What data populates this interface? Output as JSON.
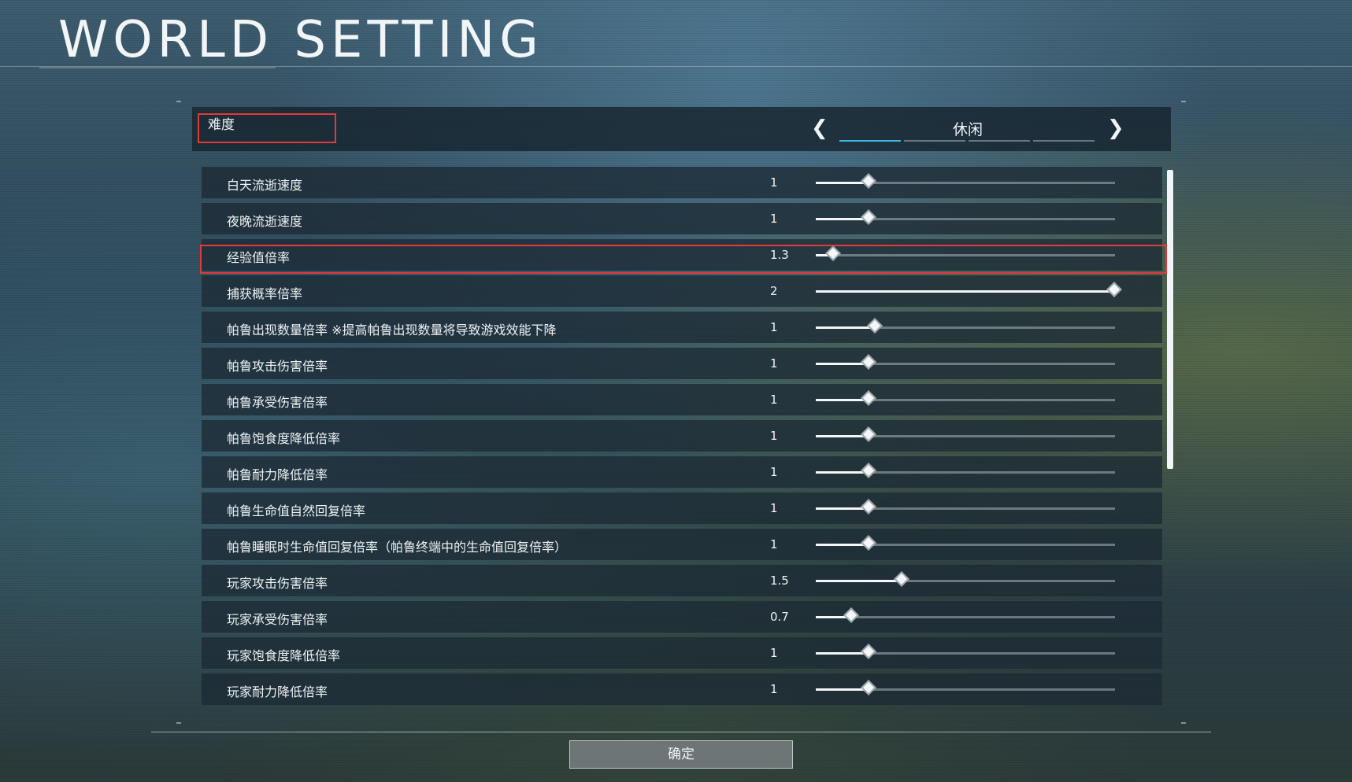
{
  "title": "WORLD SETTING",
  "difficulty": {
    "label": "难度",
    "value": "休闲",
    "segments": 4,
    "active_segment": 0
  },
  "settings": [
    {
      "label": "白天流逝速度",
      "value": "1",
      "fraction": 0.18
    },
    {
      "label": "夜晚流逝速度",
      "value": "1",
      "fraction": 0.18
    },
    {
      "label": "经验值倍率",
      "value": "1.3",
      "fraction": 0.06
    },
    {
      "label": "捕获概率倍率",
      "value": "2",
      "fraction": 1.0
    },
    {
      "label": "帕鲁出现数量倍率 ※提高帕鲁出现数量将导致游戏效能下降",
      "value": "1",
      "fraction": 0.2
    },
    {
      "label": "帕鲁攻击伤害倍率",
      "value": "1",
      "fraction": 0.18
    },
    {
      "label": "帕鲁承受伤害倍率",
      "value": "1",
      "fraction": 0.18
    },
    {
      "label": "帕鲁饱食度降低倍率",
      "value": "1",
      "fraction": 0.18
    },
    {
      "label": "帕鲁耐力降低倍率",
      "value": "1",
      "fraction": 0.18
    },
    {
      "label": "帕鲁生命值自然回复倍率",
      "value": "1",
      "fraction": 0.18
    },
    {
      "label": "帕鲁睡眠时生命值回复倍率（帕鲁终端中的生命值回复倍率）",
      "value": "1",
      "fraction": 0.18
    },
    {
      "label": "玩家攻击伤害倍率",
      "value": "1.5",
      "fraction": 0.29
    },
    {
      "label": "玩家承受伤害倍率",
      "value": "0.7",
      "fraction": 0.12
    },
    {
      "label": "玩家饱食度降低倍率",
      "value": "1",
      "fraction": 0.18
    },
    {
      "label": "玩家耐力降低倍率",
      "value": "1",
      "fraction": 0.18
    }
  ],
  "highlighted_index": 2,
  "scroll_fraction": 0.55,
  "confirm_label": "确定",
  "colors": {
    "accent": "#3fb8e8",
    "highlight": "#e03a3a"
  }
}
